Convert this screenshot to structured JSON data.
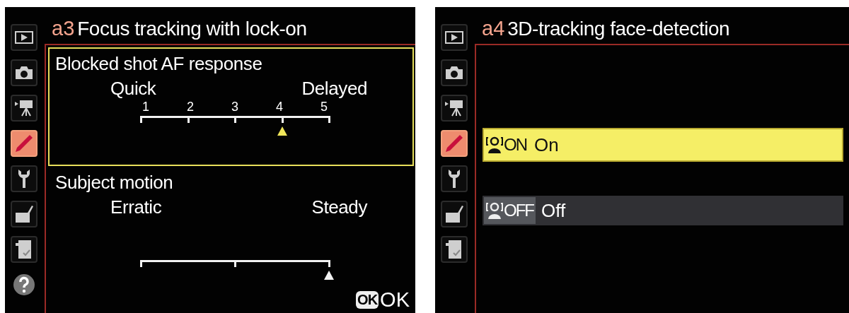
{
  "screens": [
    {
      "kind": "sliders",
      "code": "a3",
      "title": "Focus tracking with lock-on",
      "tabs": [
        {
          "kind": "playback",
          "selected": false
        },
        {
          "kind": "camera",
          "selected": false
        },
        {
          "kind": "movie",
          "selected": false
        },
        {
          "kind": "pencil",
          "selected": true
        },
        {
          "kind": "wrench",
          "selected": false
        },
        {
          "kind": "retouch",
          "selected": false
        },
        {
          "kind": "mymenu",
          "selected": false
        },
        {
          "kind": "help",
          "selected": false
        }
      ],
      "settings": [
        {
          "label": "Blocked shot AF response",
          "focused": true,
          "min_label": "Quick",
          "max_label": "Delayed",
          "ticks": [
            "1",
            "2",
            "3",
            "4",
            "5"
          ],
          "level": 0.75
        },
        {
          "label": "Subject motion",
          "focused": false,
          "min_label": "Erratic",
          "max_label": "Steady",
          "level": 1
        }
      ],
      "ok": {
        "key": "OK",
        "label": "OK"
      }
    },
    {
      "kind": "options",
      "code": "a4",
      "title": "3D-tracking face-detection",
      "tabs": [
        {
          "kind": "playback",
          "selected": false
        },
        {
          "kind": "camera",
          "selected": false
        },
        {
          "kind": "movie",
          "selected": false
        },
        {
          "kind": "pencil",
          "selected": true
        },
        {
          "kind": "wrench",
          "selected": false
        },
        {
          "kind": "retouch",
          "selected": false
        },
        {
          "kind": "mymenu",
          "selected": false
        }
      ],
      "options": [
        {
          "badge": "ON",
          "label": "On",
          "selected": true
        },
        {
          "badge": "OFF",
          "label": "Off",
          "selected": false
        }
      ]
    }
  ]
}
